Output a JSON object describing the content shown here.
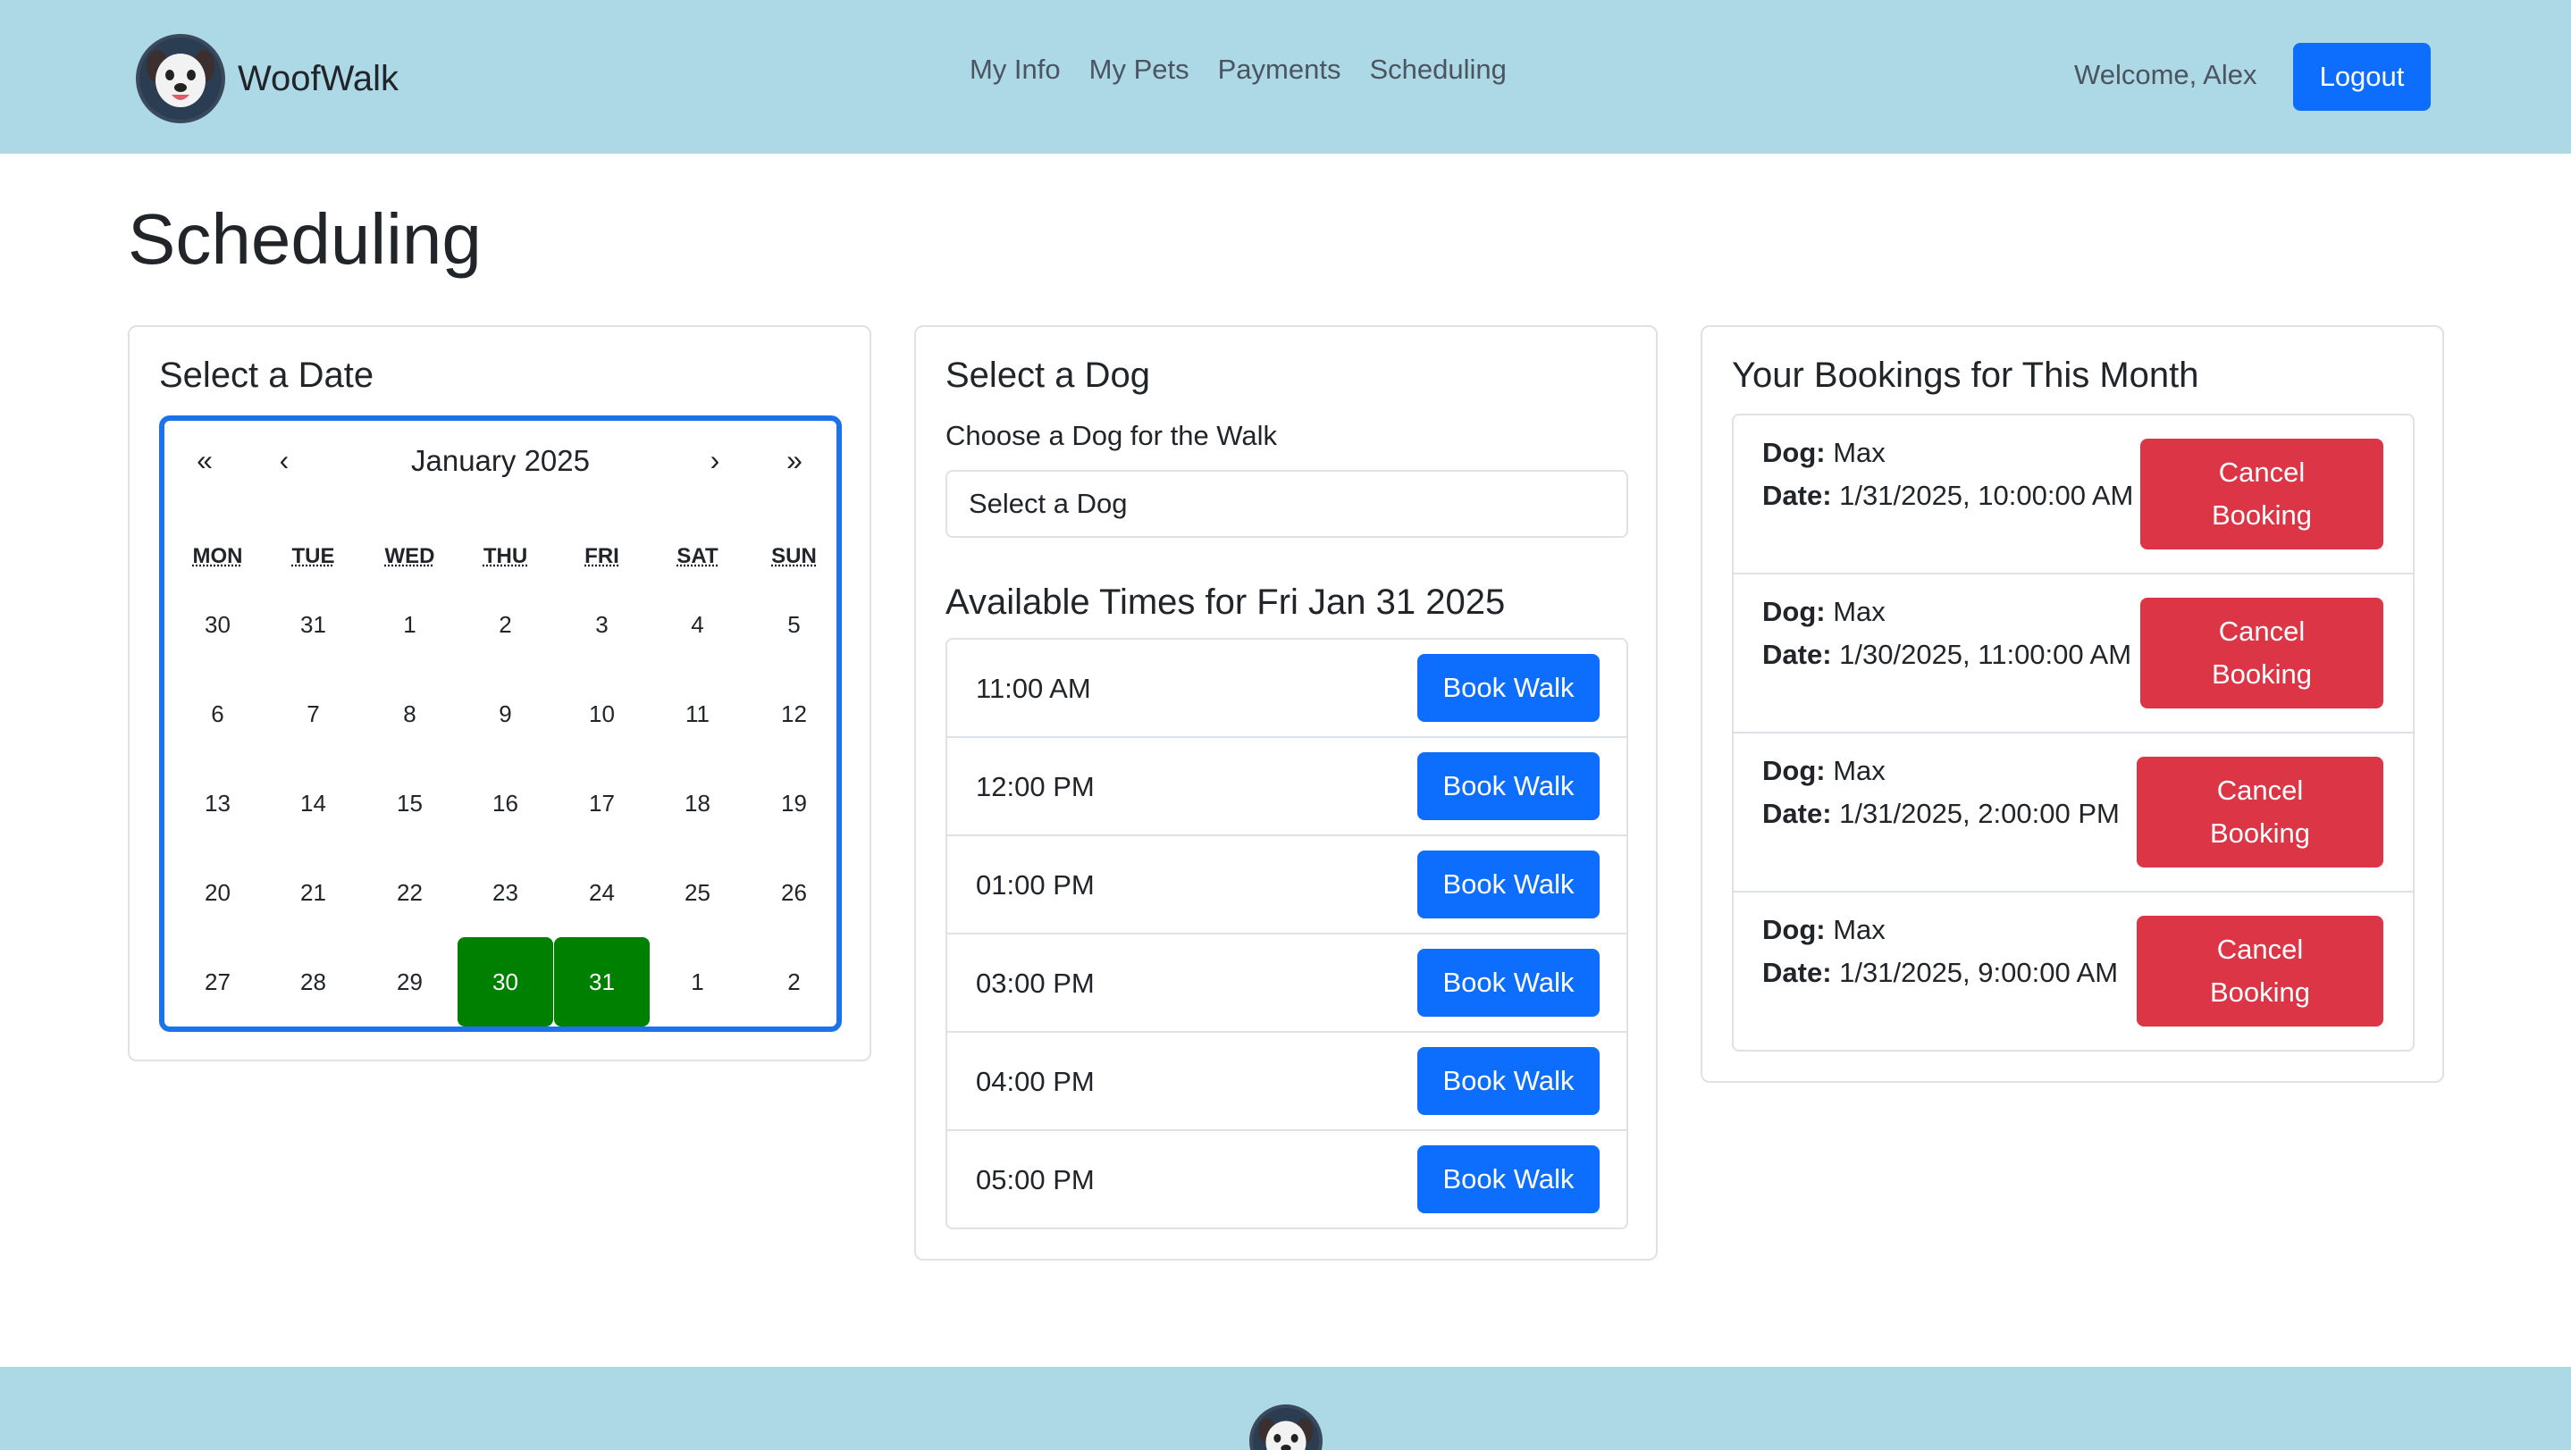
{
  "brand": {
    "name": "WoofWalk",
    "logo_icon": "dog-logo-icon"
  },
  "nav": {
    "links": [
      "My Info",
      "My Pets",
      "Payments",
      "Scheduling"
    ],
    "welcome": "Welcome, Alex",
    "logout_label": "Logout"
  },
  "page": {
    "title": "Scheduling"
  },
  "date_card": {
    "title": "Select a Date",
    "calendar": {
      "month_label": "January 2025",
      "prev_year": "«",
      "prev_month": "‹",
      "next_month": "›",
      "next_year": "»",
      "weekdays": [
        "MON",
        "TUE",
        "WED",
        "THU",
        "FRI",
        "SAT",
        "SUN"
      ],
      "weeks": [
        [
          "30",
          "31",
          "1",
          "2",
          "3",
          "4",
          "5"
        ],
        [
          "6",
          "7",
          "8",
          "9",
          "10",
          "11",
          "12"
        ],
        [
          "13",
          "14",
          "15",
          "16",
          "17",
          "18",
          "19"
        ],
        [
          "20",
          "21",
          "22",
          "23",
          "24",
          "25",
          "26"
        ],
        [
          "27",
          "28",
          "29",
          "30",
          "31",
          "1",
          "2"
        ]
      ],
      "highlighted_days": [
        "30",
        "31"
      ],
      "highlight_color": "#008000",
      "border_color": "#1a73e8"
    }
  },
  "dog_card": {
    "title": "Select a Dog",
    "label": "Choose a Dog for the Walk",
    "select_value": "Select a Dog",
    "available_title": "Available Times for Fri Jan 31 2025",
    "times": [
      {
        "time": "11:00 AM",
        "button": "Book Walk"
      },
      {
        "time": "12:00 PM",
        "button": "Book Walk"
      },
      {
        "time": "01:00 PM",
        "button": "Book Walk"
      },
      {
        "time": "03:00 PM",
        "button": "Book Walk"
      },
      {
        "time": "04:00 PM",
        "button": "Book Walk"
      },
      {
        "time": "05:00 PM",
        "button": "Book Walk"
      }
    ]
  },
  "bookings_card": {
    "title": "Your Bookings for This Month",
    "dog_label": "Dog:",
    "date_label": "Date:",
    "bookings": [
      {
        "dog": "Max",
        "date": "1/31/2025, 10:00:00 AM",
        "button": "Cancel Booking"
      },
      {
        "dog": "Max",
        "date": "1/30/2025, 11:00:00 AM",
        "button": "Cancel Booking"
      },
      {
        "dog": "Max",
        "date": "1/31/2025, 2:00:00 PM",
        "button": "Cancel Booking"
      },
      {
        "dog": "Max",
        "date": "1/31/2025, 9:00:00 AM",
        "button": "Cancel Booking"
      }
    ]
  },
  "colors": {
    "navbar_bg": "#add8e6",
    "primary": "#0d6efd",
    "danger": "#dc3545",
    "success": "#008000"
  }
}
